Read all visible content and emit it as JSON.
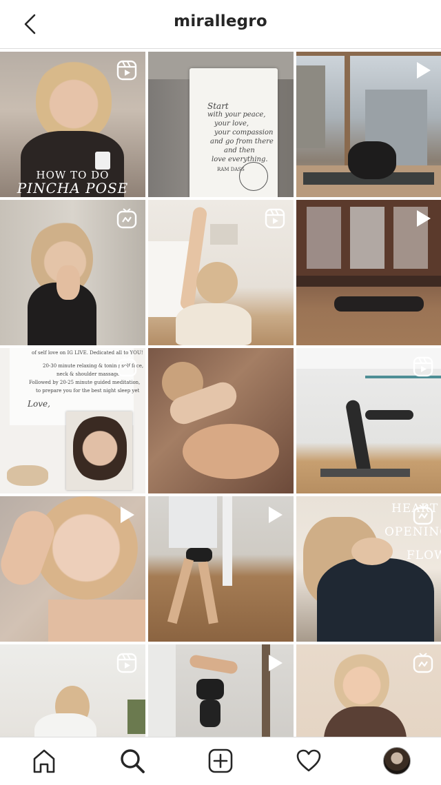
{
  "header": {
    "title": "mirallegro"
  },
  "tiles": [
    {
      "badge": "reels-icon",
      "caption_line1": "HOW TO DO",
      "caption_line2": "PINCHA POSE"
    },
    {
      "badge": "none",
      "note_line1": "Start",
      "note_line2": "with your peace,",
      "note_line3": "your love,",
      "note_line4": "your compassion",
      "note_line5": "and go from there",
      "note_line6": "and then",
      "note_line7": "love everything.",
      "note_author": "RAM DASS"
    },
    {
      "badge": "play-icon"
    },
    {
      "badge": "igtv-icon"
    },
    {
      "badge": "reels-icon"
    },
    {
      "badge": "play-icon"
    },
    {
      "badge": "igtv-icon",
      "text_line1": "of self love on IG LIVE. Dedicated all to YOU!",
      "text_line2": "20-30 minute relaxing & toning self face,",
      "text_line3": "neck & shoulder massage.",
      "text_line4": "Followed by 20-25 minute guided meditation,",
      "text_line5": "to prepare you for the best night sleep yet",
      "text_sign": "Love,"
    },
    {
      "badge": "none"
    },
    {
      "badge": "reels-icon"
    },
    {
      "badge": "play-icon"
    },
    {
      "badge": "play-icon"
    },
    {
      "badge": "igtv-icon",
      "overlay_line1": "HEART",
      "overlay_line2": "OPENING",
      "overlay_line3": "FLOW"
    },
    {
      "badge": "reels-icon"
    },
    {
      "badge": "play-icon"
    },
    {
      "badge": "igtv-icon"
    }
  ]
}
